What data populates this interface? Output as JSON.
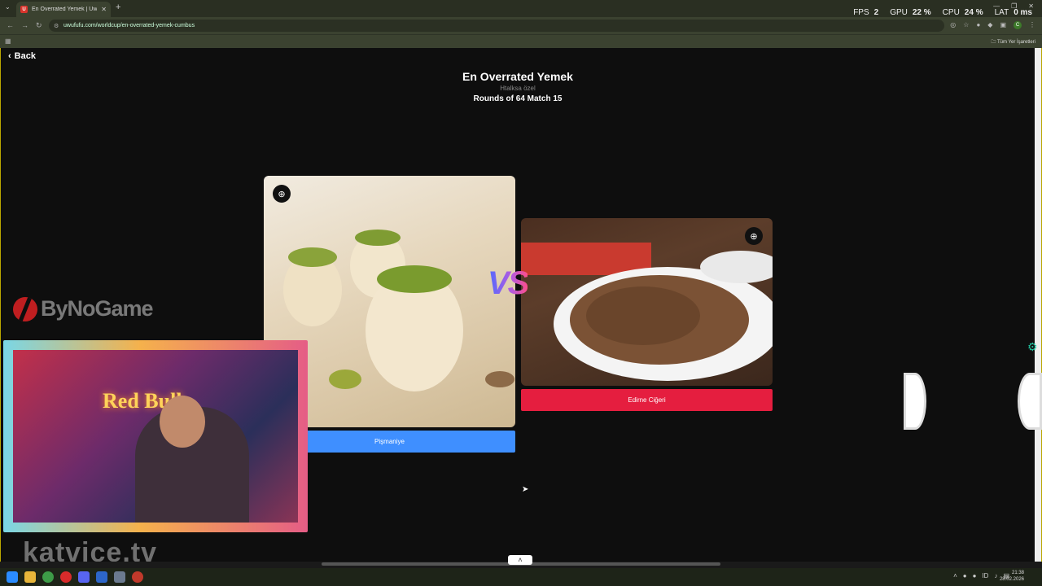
{
  "browser": {
    "tab_title": "En Overrated Yemek | UwUFUFU",
    "tab_favicon": "U",
    "url": "uwufufu.com/worldcup/en-overrated-yemek-cumbus",
    "bookmarks_folder": "Tüm Yer İşaretleri",
    "avatar_letter": "C"
  },
  "overlay_stats": {
    "fps_label": "FPS",
    "fps": "2",
    "gpu_label": "GPU",
    "gpu": "22 %",
    "cpu_label": "CPU",
    "cpu": "24 %",
    "lat_label": "LAT",
    "lat": "0 ms"
  },
  "page": {
    "back_label": "Back",
    "title": "En Overrated Yemek",
    "subtitle": "Htalksa özel",
    "round": "Rounds of 64 Match 15",
    "vs": "VS"
  },
  "candidates": [
    {
      "name": "Pişmaniye",
      "color": "#3f8fff"
    },
    {
      "name": "Edirne Ciğeri",
      "color": "#e51e3f"
    }
  ],
  "stream": {
    "sponsor": "ByNoGame",
    "webcam_sign": "Red Bull",
    "watermark": "katvice.tv"
  },
  "taskbar": {
    "time": "21:38",
    "date": "28.02.2026",
    "lang": "ID"
  },
  "icons": [
    "chevron-left-icon",
    "zoom-in-icon",
    "search-icon",
    "gear-icon",
    "windows-icon"
  ]
}
